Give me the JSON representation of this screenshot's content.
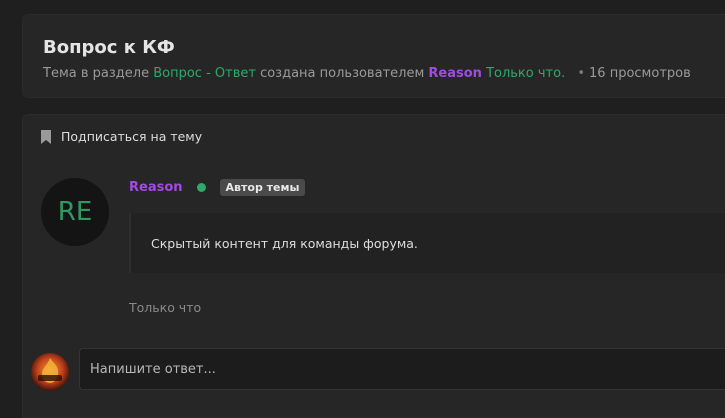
{
  "topic": {
    "title": "Вопрос к КФ",
    "meta_prefix": "Тема в разделе",
    "section": "Вопрос - Ответ",
    "created_by": "создана пользователем",
    "author": "Reason",
    "created_time": "Только что.",
    "views": "16 просмотров"
  },
  "subscribe": {
    "label": "Подписаться на тему",
    "icon": "bookmark-icon"
  },
  "post": {
    "avatar_initials": "RE",
    "author": "Reason",
    "badge": "Автор темы",
    "content": "Скрытый контент для команды форума.",
    "time": "Только что"
  },
  "reply": {
    "placeholder": "Напишите ответ..."
  },
  "colors": {
    "accent_green": "#2ea96b",
    "author_purple": "#a04ce0",
    "background": "#1f1f1f",
    "panel": "#262626"
  }
}
